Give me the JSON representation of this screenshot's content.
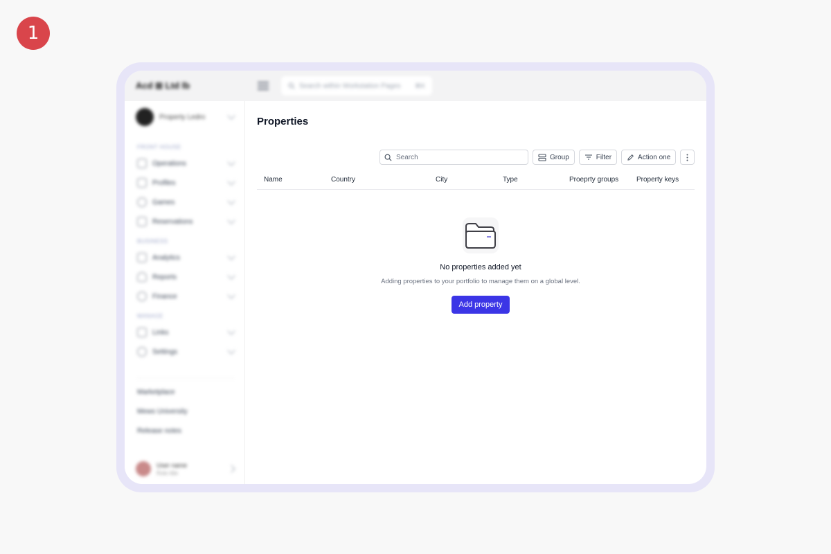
{
  "step_badge": "1",
  "topbar": {
    "brand": "Acd ⊞ Ltd lb",
    "search_placeholder": "Search within Workstation Pages",
    "search_shortcut": "⌘K"
  },
  "sidebar": {
    "workspace_name": "Property Ledro",
    "sections": [
      {
        "label": "Front house",
        "items": [
          {
            "label": "Operations",
            "icon": "inbox-icon"
          },
          {
            "label": "Profiles",
            "icon": "users-icon"
          },
          {
            "label": "Games",
            "icon": "circle-icon"
          },
          {
            "label": "Reservations",
            "icon": "calendar-icon"
          }
        ]
      },
      {
        "label": "Business",
        "items": [
          {
            "label": "Analytics",
            "icon": "chart-icon"
          },
          {
            "label": "Reports",
            "icon": "person-icon"
          },
          {
            "label": "Finance",
            "icon": "coin-icon"
          }
        ]
      },
      {
        "label": "Manage",
        "items": [
          {
            "label": "Links",
            "icon": "link-icon"
          },
          {
            "label": "Settings",
            "icon": "gear-icon"
          }
        ]
      }
    ],
    "footer_links": [
      "Marketplace",
      "Mews University",
      "Release notes"
    ],
    "user": {
      "name": "User name",
      "subtitle": "Role title"
    }
  },
  "main": {
    "title": "Properties",
    "search_placeholder": "Search",
    "buttons": {
      "group": "Group",
      "filter": "Filter",
      "action": "Action one"
    },
    "columns": [
      "Name",
      "Country",
      "City",
      "Type",
      "Proeprty groups",
      "Property keys"
    ],
    "empty": {
      "title": "No properties added yet",
      "description": "Adding properties to your portfolio to manage them on a global level.",
      "cta": "Add property"
    }
  },
  "colors": {
    "accent": "#3b35e6",
    "badge": "#d9454b",
    "frame": "#e7e5f8"
  }
}
